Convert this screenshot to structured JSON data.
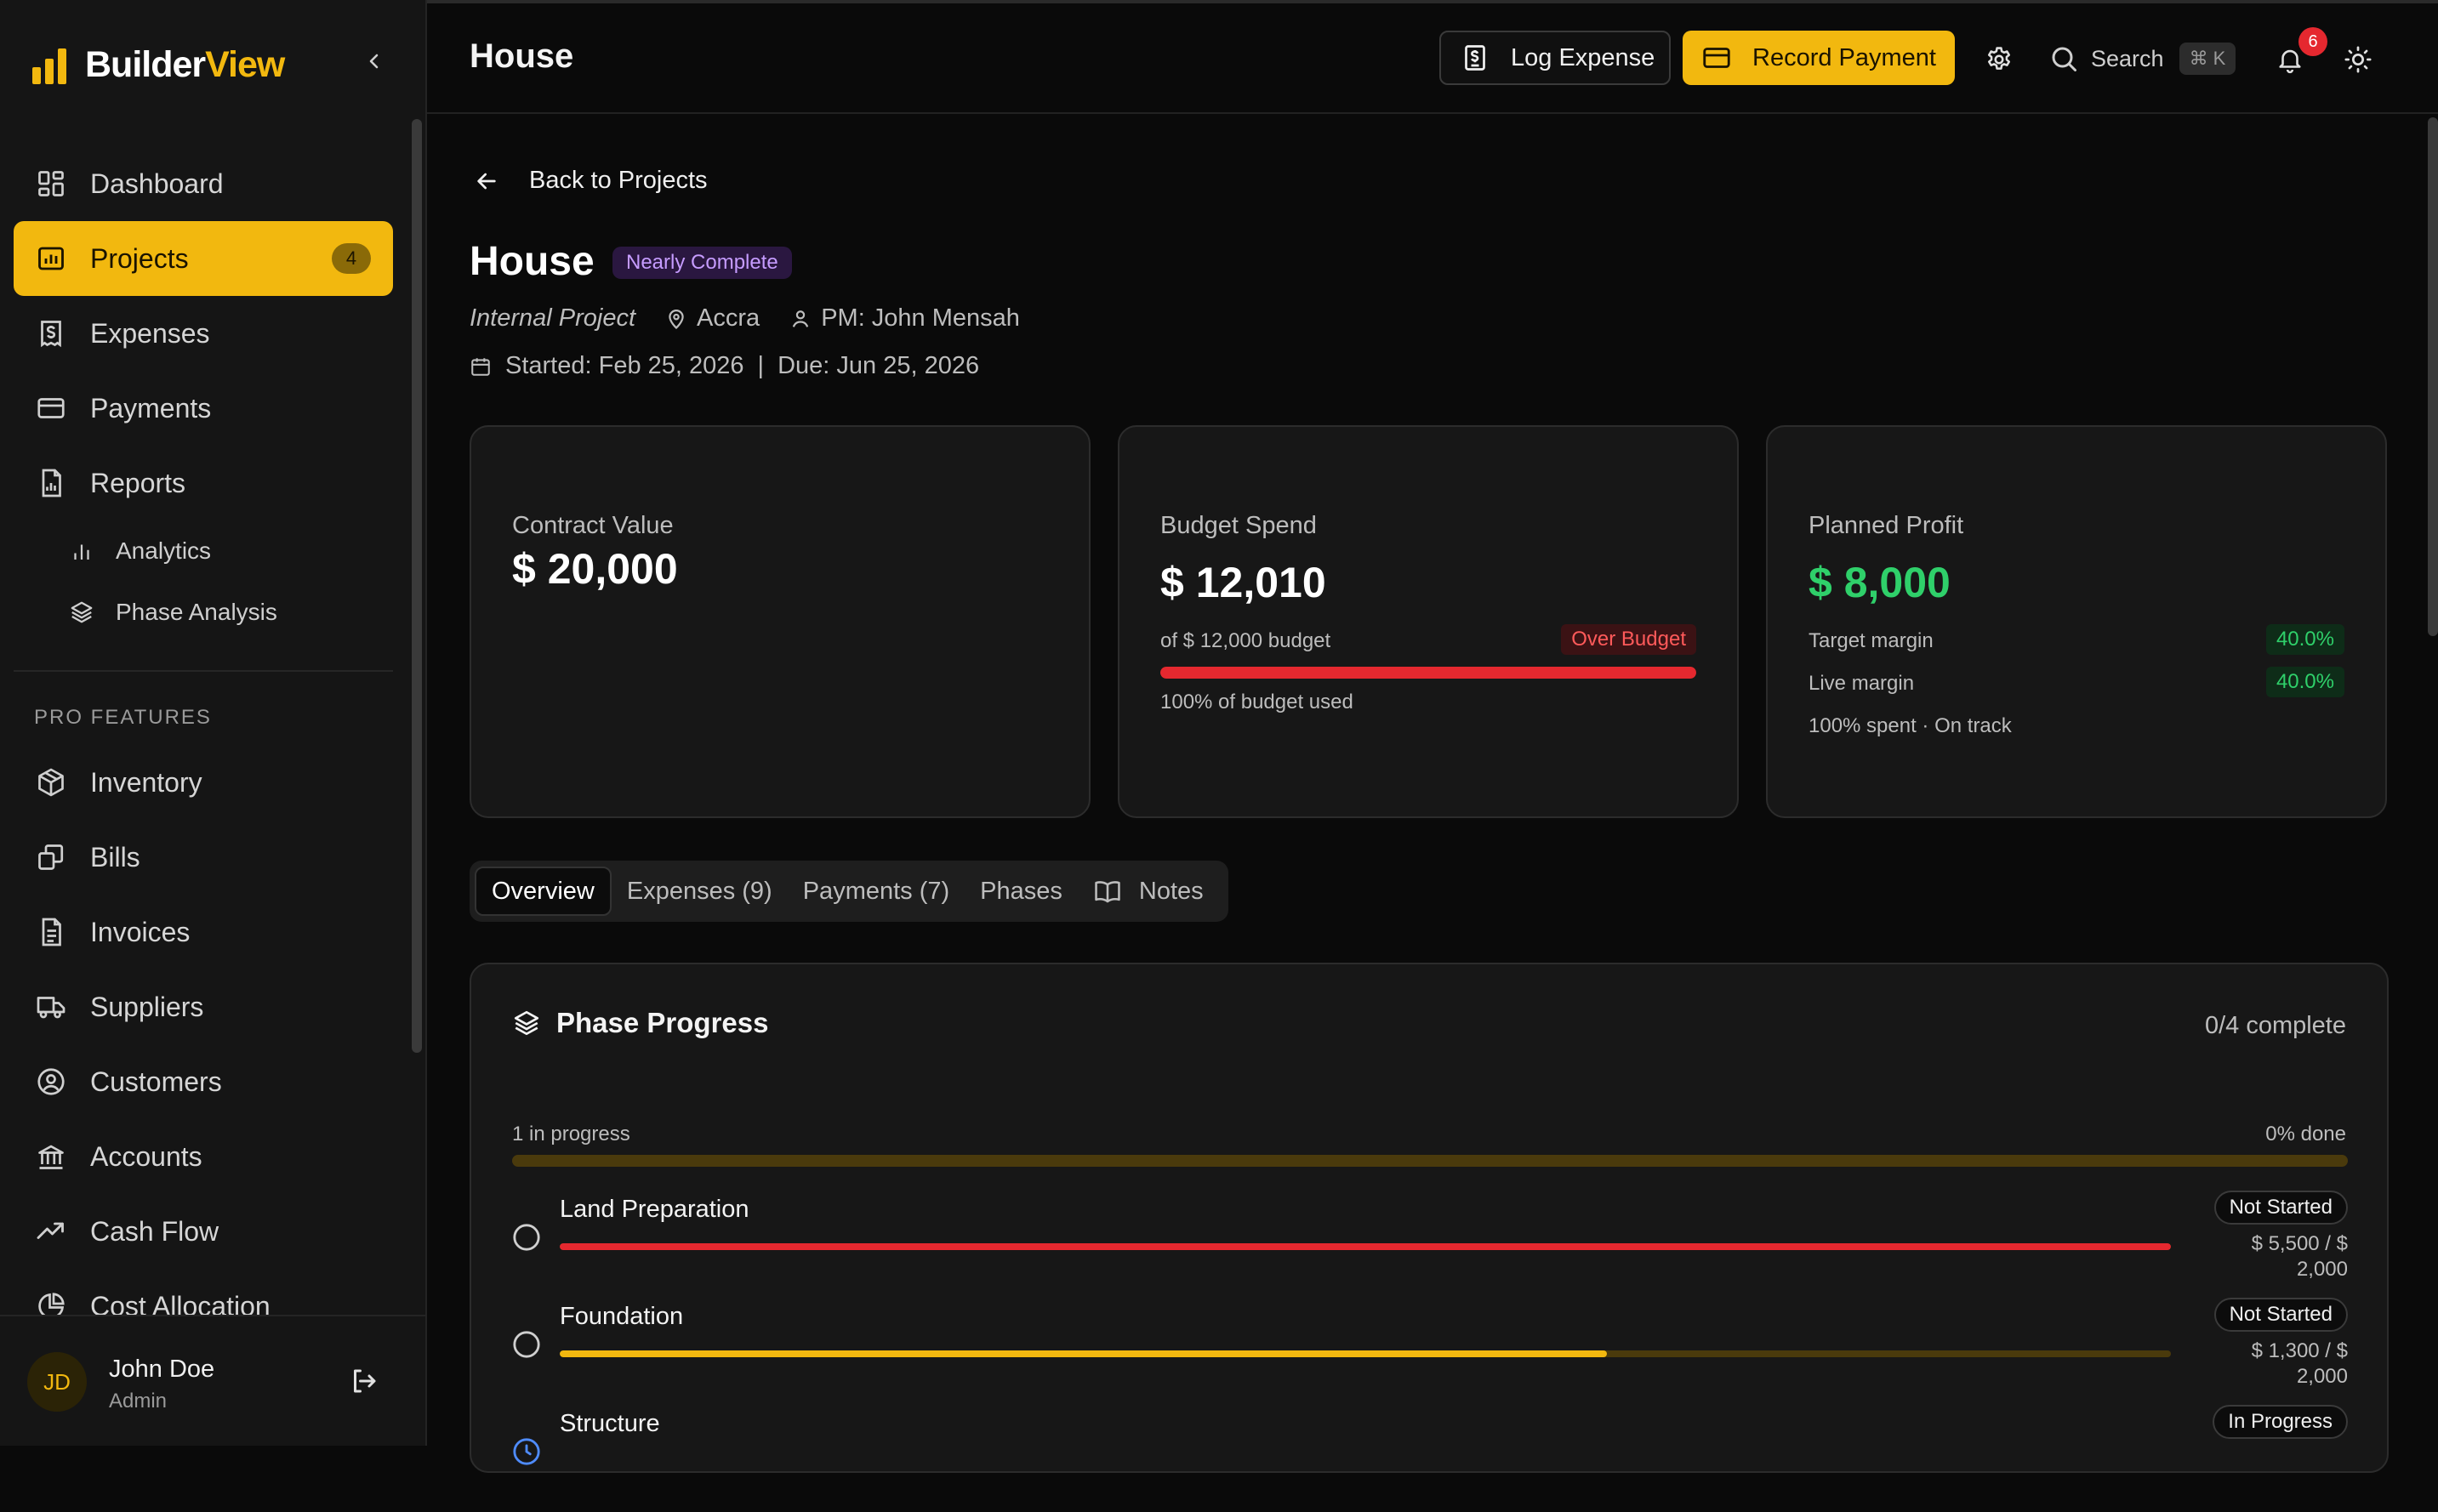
{
  "brand": {
    "part1": "Builder",
    "part2": "View",
    "accent": "#f2b80f"
  },
  "sidebar": {
    "items": [
      {
        "label": "Dashboard",
        "icon": "dashboard-icon"
      },
      {
        "label": "Projects",
        "icon": "projects-icon",
        "badge": "4",
        "active": true
      },
      {
        "label": "Expenses",
        "icon": "expenses-icon"
      },
      {
        "label": "Payments",
        "icon": "payments-icon"
      },
      {
        "label": "Reports",
        "icon": "reports-icon"
      }
    ],
    "sub_items": [
      {
        "label": "Analytics",
        "icon": "analytics-icon"
      },
      {
        "label": "Phase Analysis",
        "icon": "layers-icon"
      }
    ],
    "section_label": "PRO FEATURES",
    "pro_items": [
      {
        "label": "Inventory",
        "icon": "box-icon"
      },
      {
        "label": "Bills",
        "icon": "bills-icon"
      },
      {
        "label": "Invoices",
        "icon": "invoice-icon"
      },
      {
        "label": "Suppliers",
        "icon": "truck-icon"
      },
      {
        "label": "Customers",
        "icon": "user-circle-icon"
      },
      {
        "label": "Accounts",
        "icon": "bank-icon"
      },
      {
        "label": "Cash Flow",
        "icon": "trend-icon"
      },
      {
        "label": "Cost Allocation",
        "icon": "pie-icon"
      }
    ],
    "user": {
      "initials": "JD",
      "name": "John Doe",
      "role": "Admin"
    }
  },
  "topbar": {
    "title": "House",
    "log_expense": "Log Expense",
    "record_payment": "Record Payment",
    "search_label": "Search",
    "search_shortcut": "⌘ K",
    "notification_count": "6"
  },
  "project": {
    "back_label": "Back to Projects",
    "name": "House",
    "status": "Nearly Complete",
    "type": "Internal Project",
    "location": "Accra",
    "pm": "PM: John Mensah",
    "started": "Started: Feb 25, 2026",
    "separator": "|",
    "due": "Due: Jun 25, 2026"
  },
  "cards": {
    "contract": {
      "label": "Contract Value",
      "value": "$ 20,000"
    },
    "budget": {
      "label": "Budget Spend",
      "value": "$ 12,010",
      "of_budget": "of $ 12,000 budget",
      "flag": "Over Budget",
      "used_text": "100% of budget used",
      "progress": 1.0
    },
    "profit": {
      "label": "Planned Profit",
      "value": "$ 8,000",
      "target_label": "Target margin",
      "target_value": "40.0%",
      "live_label": "Live margin",
      "live_value": "40.0%",
      "status_text": "100% spent · On track"
    }
  },
  "tabs": [
    {
      "label": "Overview",
      "active": true
    },
    {
      "label": "Expenses (9)"
    },
    {
      "label": "Payments (7)"
    },
    {
      "label": "Phases"
    },
    {
      "label": "Notes",
      "icon": "book-icon"
    }
  ],
  "phase_progress": {
    "title": "Phase Progress",
    "complete": "0/4 complete",
    "in_progress": "1 in progress",
    "done": "0% done",
    "phases": [
      {
        "name": "Land Preparation",
        "status": "Not Started",
        "cost_line1": "$ 5,500 / $",
        "cost_line2": "2,000",
        "progress": 1.0,
        "color": "#e5282f"
      },
      {
        "name": "Foundation",
        "status": "Not Started",
        "cost_line1": "$ 1,300 / $",
        "cost_line2": "2,000",
        "progress": 0.65,
        "color": "#f2b80f"
      },
      {
        "name": "Structure",
        "status": "In Progress",
        "cost_line1": "",
        "cost_line2": "",
        "progress": 0,
        "color": "#f2b80f"
      }
    ]
  },
  "colors": {
    "accent": "#f2b80f",
    "danger": "#e5282f",
    "success": "#2fd06a",
    "purple": "#c69cff"
  }
}
